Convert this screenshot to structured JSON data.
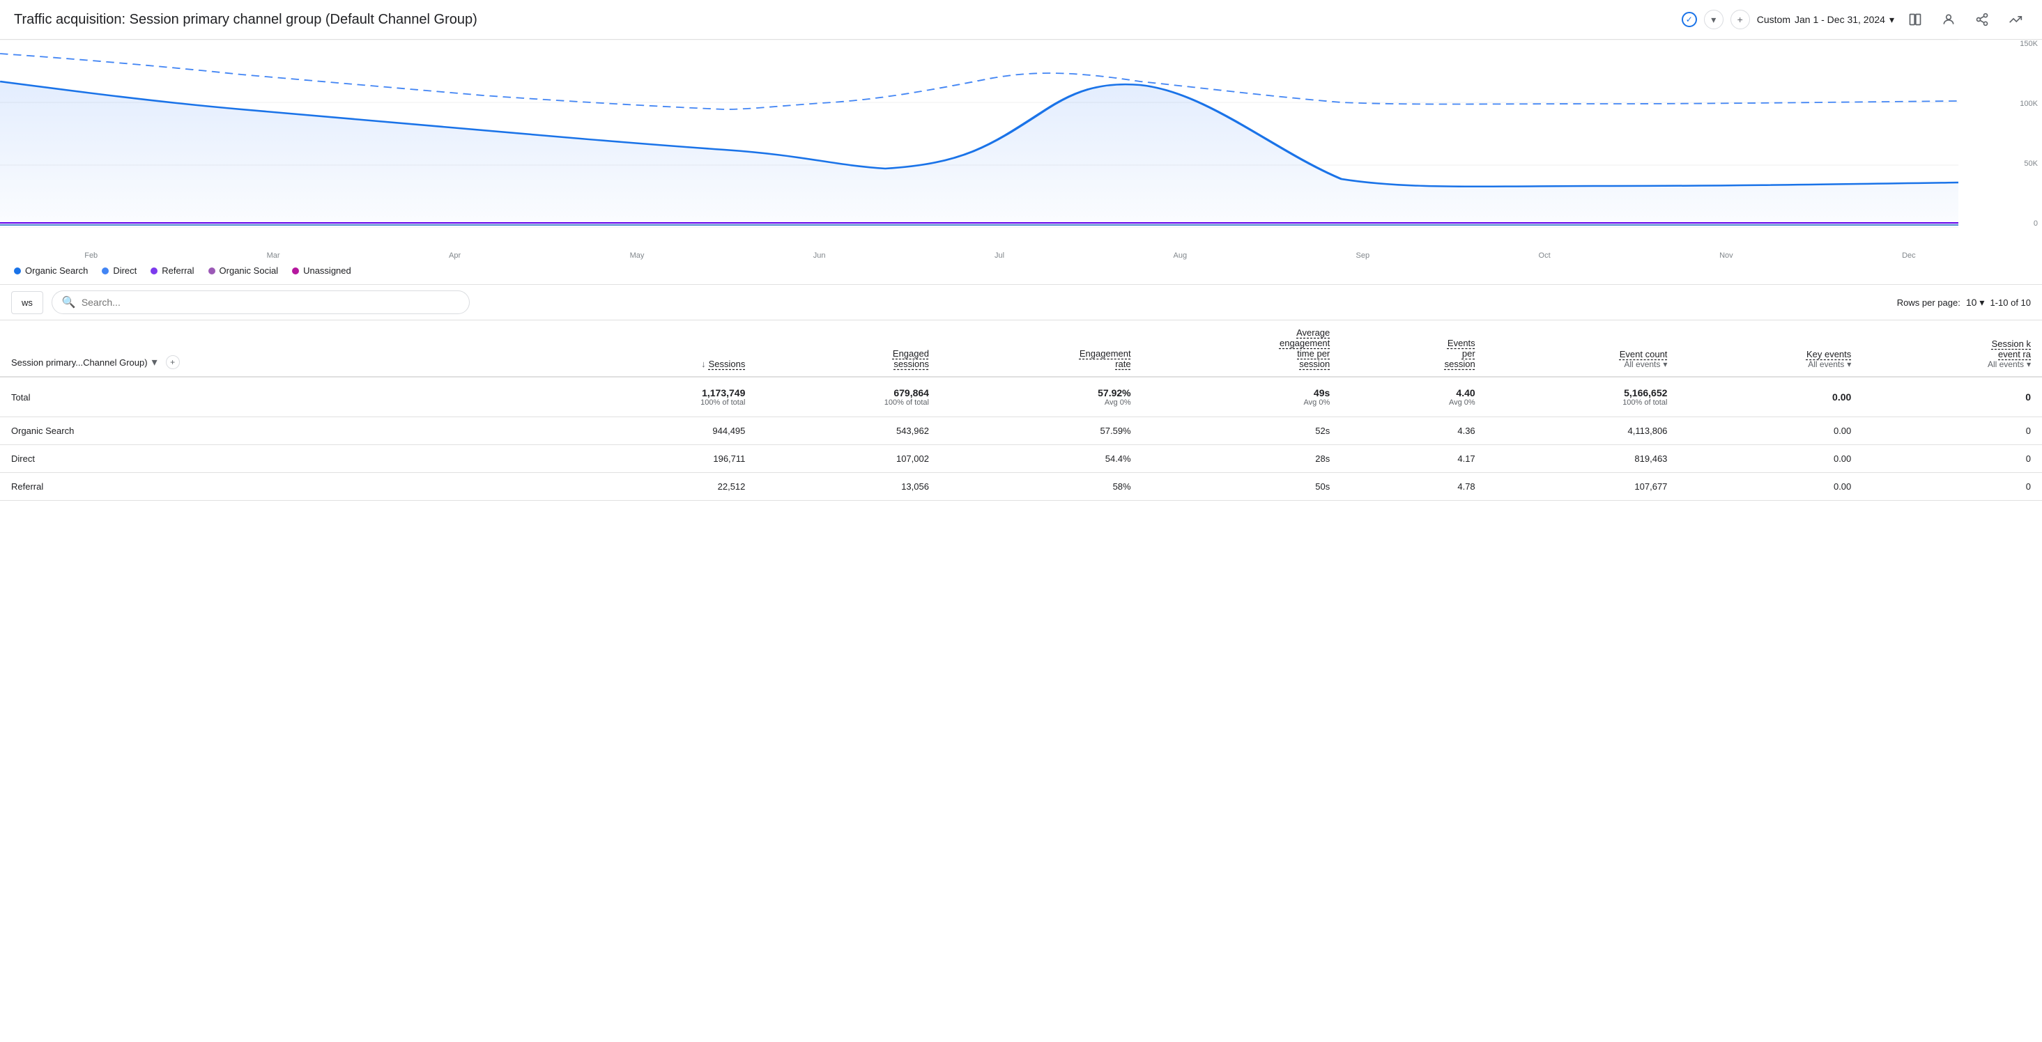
{
  "header": {
    "title": "Traffic acquisition: Session primary channel group (Default Channel Group)",
    "date_range_label": "Custom",
    "date_range_value": "Jan 1 - Dec 31, 2024",
    "check_icon": "✓",
    "add_icon": "+",
    "dropdown_arrow": "▾"
  },
  "chart": {
    "y_labels": [
      "150K",
      "100K",
      "50K",
      "0"
    ],
    "x_labels": [
      "Feb",
      "Mar",
      "Apr",
      "May",
      "Jun",
      "Jul",
      "Aug",
      "Sep",
      "Oct",
      "Nov",
      "Dec"
    ],
    "solid_line_color": "#1a73e8",
    "dotted_line_color": "#4285f4",
    "fill_color": "rgba(66,133,244,0.08)"
  },
  "legend": {
    "items": [
      {
        "label": "Organic Search",
        "color": "#1a73e8",
        "dot": false
      },
      {
        "label": "Direct",
        "color": "#4285f4",
        "dot": true
      },
      {
        "label": "Referral",
        "color": "#7c3aed",
        "dot": true
      },
      {
        "label": "Organic Social",
        "color": "#9b59b6",
        "dot": true
      },
      {
        "label": "Unassigned",
        "color": "#b5179e",
        "dot": true
      }
    ]
  },
  "toolbar": {
    "search_placeholder": "Search...",
    "rows_per_page_label": "Rows per page:",
    "rows_per_page_value": "10",
    "pagination_info": "1-10 of 10",
    "views_tab_label": "ws"
  },
  "table": {
    "dimension_header": "Session primary...Channel Group)",
    "columns": [
      {
        "label": "Sessions",
        "sort": "↓",
        "underline": true
      },
      {
        "label": "Engaged\nsessions",
        "underline": true
      },
      {
        "label": "Engagement\nrate",
        "underline": true
      },
      {
        "label": "Average\nengagement\ntime per\nsession",
        "underline": true
      },
      {
        "label": "Events\nper\nsession",
        "underline": true
      },
      {
        "label": "Event count",
        "sub_label": "All events",
        "underline": true,
        "has_filter": true
      },
      {
        "label": "Key events",
        "sub_label": "All events",
        "underline": true,
        "has_filter": true
      },
      {
        "label": "Session k\nevent ra",
        "sub_label": "All events",
        "underline": true,
        "has_filter": true
      }
    ],
    "total_row": {
      "label": "Total",
      "sessions": "1,173,749",
      "sessions_sub": "100% of total",
      "engaged_sessions": "679,864",
      "engaged_sessions_sub": "100% of total",
      "engagement_rate": "57.92%",
      "engagement_rate_sub": "Avg 0%",
      "avg_engagement_time": "49s",
      "avg_engagement_time_sub": "Avg 0%",
      "events_per_session": "4.40",
      "events_per_session_sub": "Avg 0%",
      "event_count": "5,166,652",
      "event_count_sub": "100% of total",
      "key_events": "0.00",
      "session_key_event_rate": "0"
    },
    "rows": [
      {
        "label": "Organic Search",
        "sessions": "944,495",
        "engaged_sessions": "543,962",
        "engagement_rate": "57.59%",
        "avg_engagement_time": "52s",
        "events_per_session": "4.36",
        "event_count": "4,113,806",
        "key_events": "0.00",
        "session_key_event_rate": "0"
      },
      {
        "label": "Direct",
        "sessions": "196,711",
        "engaged_sessions": "107,002",
        "engagement_rate": "54.4%",
        "avg_engagement_time": "28s",
        "events_per_session": "4.17",
        "event_count": "819,463",
        "key_events": "0.00",
        "session_key_event_rate": "0"
      },
      {
        "label": "Referral",
        "sessions": "22,512",
        "engaged_sessions": "13,056",
        "engagement_rate": "58%",
        "avg_engagement_time": "50s",
        "events_per_session": "4.78",
        "event_count": "107,677",
        "key_events": "0.00",
        "session_key_event_rate": "0"
      }
    ]
  }
}
